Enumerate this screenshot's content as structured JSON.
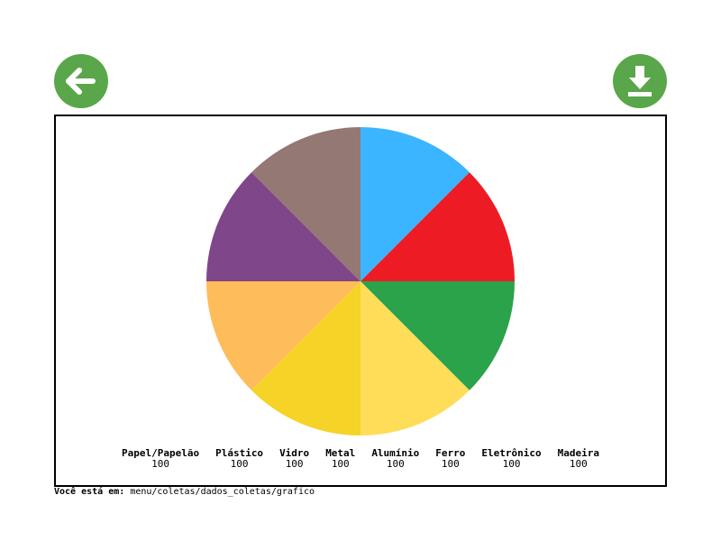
{
  "toolbar": {
    "back_color": "#5aa64a",
    "download_color": "#5aa64a"
  },
  "chart_data": {
    "type": "pie",
    "categories": [
      "Papel/Papelão",
      "Plástico",
      "Vidro",
      "Metal",
      "Alumínio",
      "Ferro",
      "Eletrônico",
      "Madeira"
    ],
    "values": [
      100,
      100,
      100,
      100,
      100,
      100,
      100,
      100
    ],
    "colors": [
      "#3bb5ff",
      "#ed1c24",
      "#2ba34a",
      "#ffdd59",
      "#f5d327",
      "#ffbc5a",
      "#7f4689",
      "#937873"
    ],
    "start": "12 o'clock",
    "direction": "clockwise",
    "legend": "bottom"
  },
  "breadcrumb": {
    "label": "Você está em:",
    "path": "menu/coletas/dados_coletas/grafico"
  }
}
